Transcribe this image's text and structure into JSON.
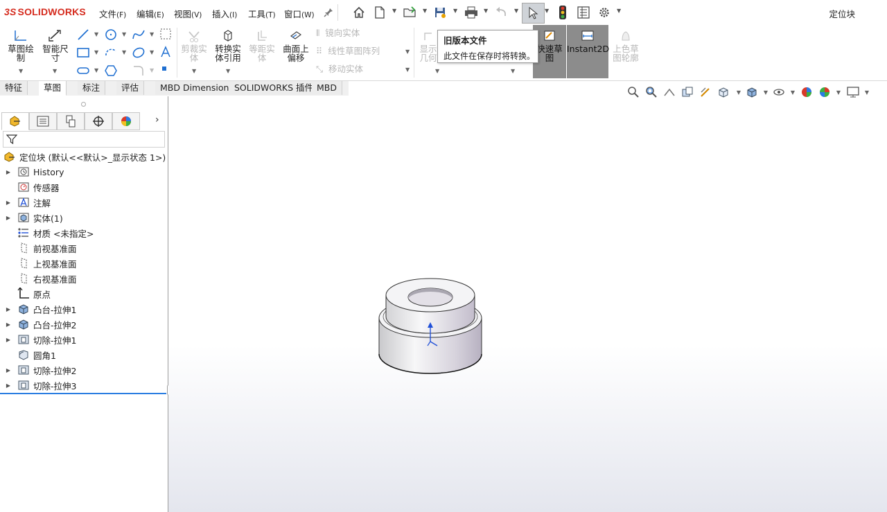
{
  "app": {
    "brand": "SOLIDWORKS",
    "brand_prefix": "3S",
    "document_title": "定位块"
  },
  "menu": {
    "items": [
      {
        "label": "文件",
        "key": "(F)"
      },
      {
        "label": "编辑",
        "key": "(E)"
      },
      {
        "label": "视图",
        "key": "(V)"
      },
      {
        "label": "插入",
        "key": "(I)"
      },
      {
        "label": "工具",
        "key": "(T)"
      },
      {
        "label": "窗口",
        "key": "(W)"
      }
    ]
  },
  "ribbon": {
    "sketch": "草图绘制",
    "smart_dim": "智能尺寸",
    "trim": "剪裁实体",
    "convert": "转换实体引用",
    "offset": "等距实体",
    "surface_offset": "曲面上偏移",
    "mirror": "镜向实体",
    "linear_pattern": "线性草图阵列",
    "move": "移动实体",
    "display": "显示几何",
    "quick_sketch": "快速草图",
    "instant2d": "Instant2D",
    "shaded": "上色草图轮廓"
  },
  "tabs": [
    "特征",
    "草图",
    "标注",
    "评估",
    "MBD Dimensions",
    "SOLIDWORKS 插件",
    "MBD"
  ],
  "active_tab_index": 1,
  "tooltip": {
    "title": "旧版本文件",
    "body": "此文件在保存时将转换。"
  },
  "tree": {
    "root": "定位块  (默认<<默认>_显示状态 1>)",
    "items": [
      {
        "label": "History",
        "expandable": true,
        "icon": "history-icon"
      },
      {
        "label": "传感器",
        "expandable": false,
        "icon": "sensor-icon"
      },
      {
        "label": "注解",
        "expandable": true,
        "icon": "annotation-icon"
      },
      {
        "label": "实体(1)",
        "expandable": true,
        "icon": "solid-bodies-icon"
      },
      {
        "label": "材质 <未指定>",
        "expandable": false,
        "icon": "material-icon"
      },
      {
        "label": "前视基准面",
        "expandable": false,
        "icon": "plane-icon"
      },
      {
        "label": "上视基准面",
        "expandable": false,
        "icon": "plane-icon"
      },
      {
        "label": "右视基准面",
        "expandable": false,
        "icon": "plane-icon"
      },
      {
        "label": "原点",
        "expandable": false,
        "icon": "origin-icon"
      },
      {
        "label": "凸台-拉伸1",
        "expandable": true,
        "icon": "boss-extrude-icon"
      },
      {
        "label": "凸台-拉伸2",
        "expandable": true,
        "icon": "boss-extrude-icon"
      },
      {
        "label": "切除-拉伸1",
        "expandable": true,
        "icon": "cut-extrude-icon"
      },
      {
        "label": "圆角1",
        "expandable": false,
        "icon": "fillet-icon"
      },
      {
        "label": "切除-拉伸2",
        "expandable": true,
        "icon": "cut-extrude-icon"
      },
      {
        "label": "切除-拉伸3",
        "expandable": true,
        "icon": "cut-extrude-icon"
      }
    ]
  },
  "colors": {
    "brand_red": "#d52b1e",
    "accent_blue": "#1f6fd1",
    "toggle_active": "#8c8c8c"
  }
}
